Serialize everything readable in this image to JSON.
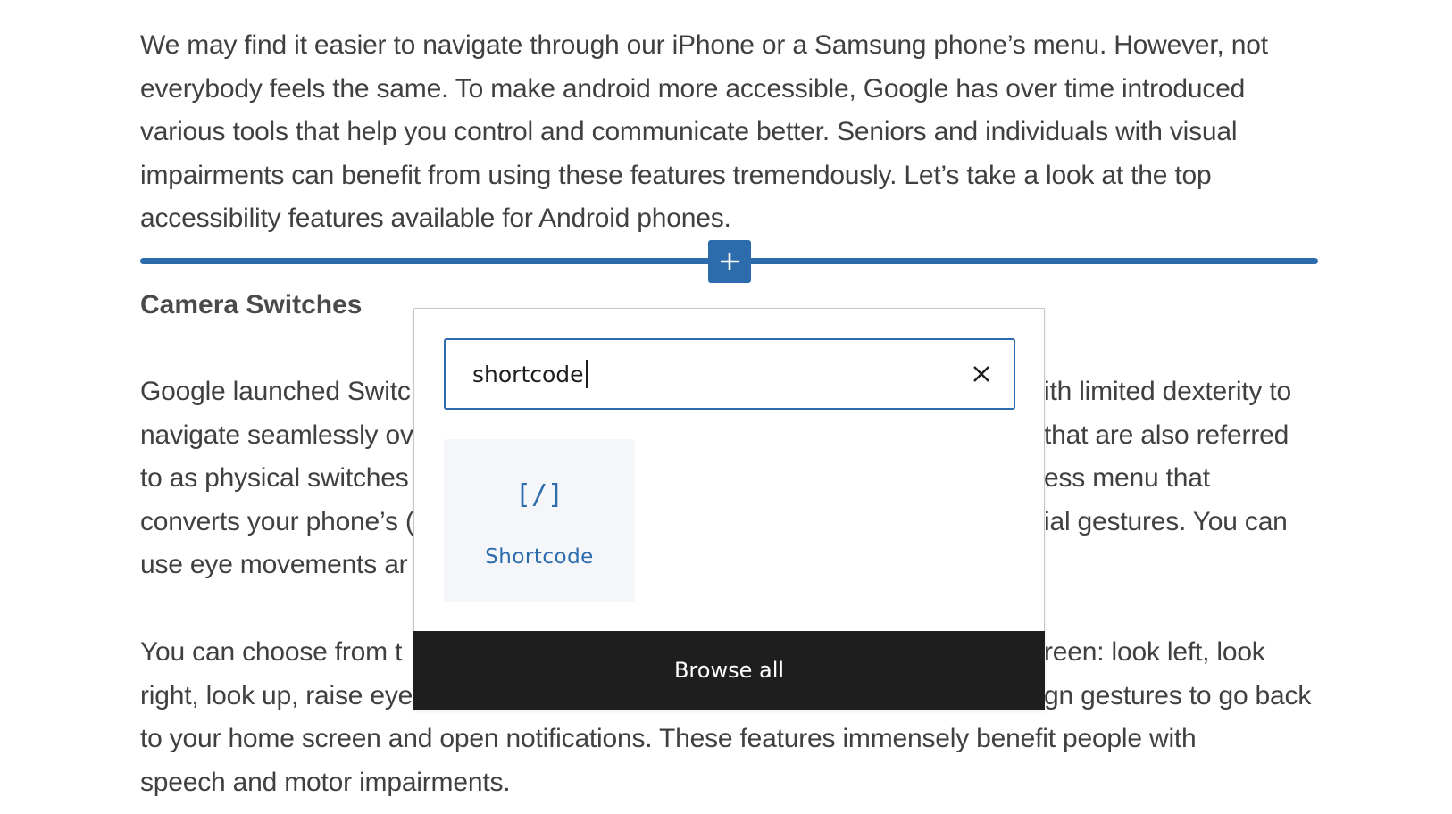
{
  "intro_lines": [
    "We may find it easier to navigate through our iPhone or a Samsung phone’s menu. However, not",
    "everybody feels the same. To make android more accessible, Google has over time introduced",
    "various tools that help you control and communicate better. Seniors and individuals with visual",
    "impairments can benefit from using these features tremendously. Let’s take a look at the top",
    "accessibility features available for Android phones."
  ],
  "heading": "Camera Switches",
  "camera_left_lines": [
    "Google launched Switc",
    "navigate seamlessly ov",
    "to as physical switches",
    "converts your phone’s (",
    "use eye movements ar"
  ],
  "camera_right_lines": [
    "ith limited dexterity to",
    "that are also referred",
    "ess menu that",
    "ial gestures. You can",
    ""
  ],
  "choose_left_lines": [
    "You can choose from t",
    "right, look up, raise eye"
  ],
  "choose_right_lines": [
    "reen: look left, look",
    "gn gestures to go back"
  ],
  "tail_lines": [
    "to your home screen and open notifications. These features immensely benefit people with",
    "speech and motor impairments."
  ],
  "inserter": {
    "search_value": "shortcode",
    "results": [
      {
        "icon": "shortcode-icon",
        "icon_glyph": "[/]",
        "label": "Shortcode"
      }
    ],
    "browse_all_label": "Browse all"
  },
  "colors": {
    "accent": "#2c6bac",
    "dark": "#1e1e1e",
    "card_bg": "#f4f6f9",
    "text": "#404040"
  }
}
